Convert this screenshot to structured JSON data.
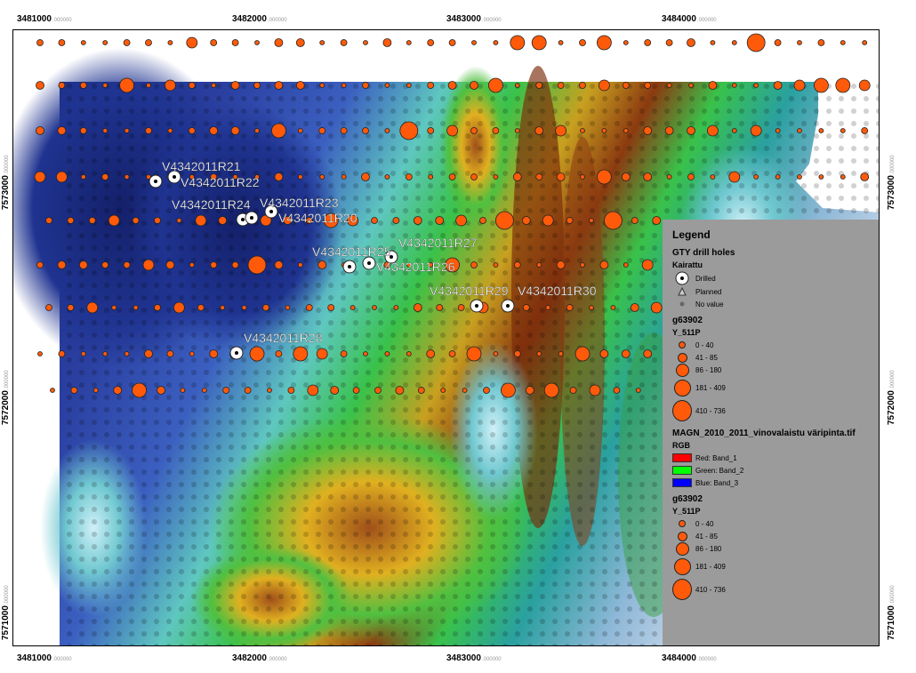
{
  "x_ticks": [
    "3481000",
    "3482000",
    "3483000",
    "3484000"
  ],
  "x_tick_suffix": ".000000",
  "y_ticks": [
    "7573000",
    "7572000",
    "7571000"
  ],
  "y_tick_suffix": ".000000",
  "drill_labels": [
    "V4342011R21",
    "V4342011R22",
    "V4342011R24",
    "V4342011R23",
    "V4342011R20",
    "V4342011R25",
    "V4342011R27",
    "V4342011R26",
    "V4342011R29",
    "V4342011R30",
    "V4342011R28"
  ],
  "legend": {
    "title": "Legend",
    "layer1": "GTY drill holes",
    "layer1_field": "Kairattu",
    "drilled": "Drilled",
    "planned": "Planned",
    "no_value": "No value",
    "layer2": "g63902",
    "layer2_field": "Y_511P",
    "classes": [
      "0 - 40",
      "41 - 85",
      "86 - 180",
      "181 - 409",
      "410 - 736"
    ],
    "raster": "MAGN_2010_2011_vinovalaistu väripinta.tif",
    "raster_type": "RGB",
    "band_red": "Red:    Band_1",
    "band_green": "Green: Band_2",
    "band_blue": "Blue:   Band_3",
    "layer3": "g63902",
    "layer3_field": "Y_511P",
    "classes2": [
      "0 - 40",
      "41 - 85",
      "86 - 180",
      "181 - 409",
      "410 - 736"
    ]
  },
  "colors": {
    "sample_fill": "#ff5a0a",
    "red": "#ff0000",
    "green": "#00ff00",
    "blue": "#0000ff"
  }
}
